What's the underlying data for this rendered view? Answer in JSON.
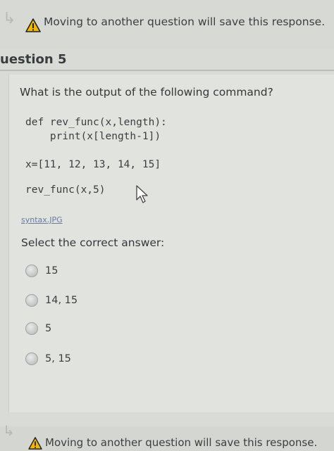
{
  "warning": {
    "text": "Moving to another question will save this response.",
    "icon": "warning-triangle-icon",
    "icon_color": "#e0a800"
  },
  "question": {
    "label": "uestion 5",
    "prompt": "What is the output of the following command?",
    "code_lines": [
      "def rev_func(x,length):",
      "    print(x[length-1])",
      "x=[11, 12, 13, 14, 15]",
      "rev_func(x,5)"
    ],
    "attachment": "syntax.JPG",
    "select_label": "Select the correct answer:",
    "options": [
      "15",
      "14, 15",
      "5",
      "5, 15"
    ]
  },
  "warning_bottom": {
    "text": "Moving to another question will save this response."
  }
}
